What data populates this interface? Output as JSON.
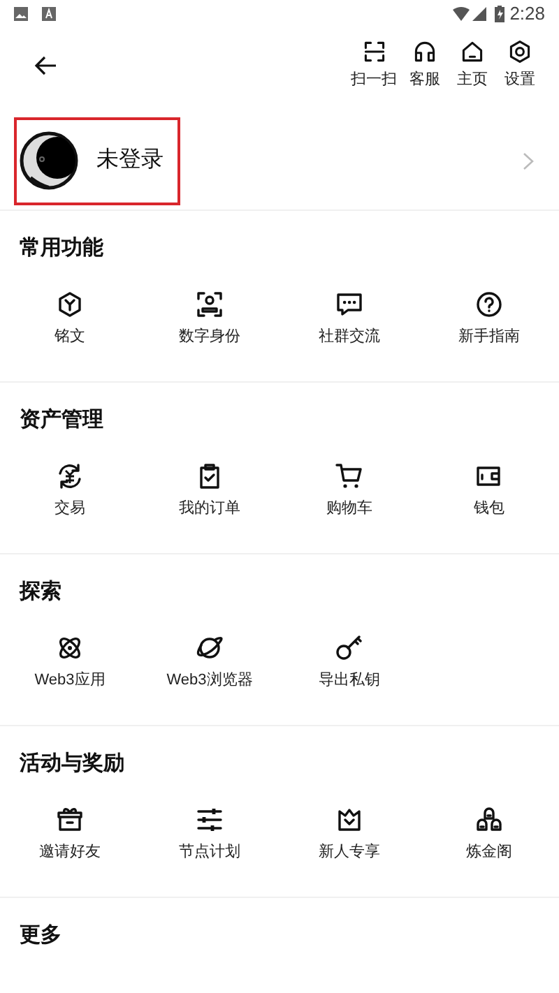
{
  "status_bar": {
    "time": "2:28"
  },
  "header": {
    "actions": [
      {
        "label": "扫一扫"
      },
      {
        "label": "客服"
      },
      {
        "label": "主页"
      },
      {
        "label": "设置"
      }
    ]
  },
  "profile": {
    "name": "未登录",
    "highlighted": true
  },
  "sections": [
    {
      "title": "常用功能",
      "items": [
        {
          "label": "铭文"
        },
        {
          "label": "数字身份"
        },
        {
          "label": "社群交流"
        },
        {
          "label": "新手指南"
        }
      ]
    },
    {
      "title": "资产管理",
      "items": [
        {
          "label": "交易"
        },
        {
          "label": "我的订单"
        },
        {
          "label": "购物车"
        },
        {
          "label": "钱包"
        }
      ]
    },
    {
      "title": "探索",
      "items": [
        {
          "label": "Web3应用"
        },
        {
          "label": "Web3浏览器"
        },
        {
          "label": "导出私钥"
        }
      ]
    },
    {
      "title": "活动与奖励",
      "items": [
        {
          "label": "邀请好友"
        },
        {
          "label": "节点计划"
        },
        {
          "label": "新人专享"
        },
        {
          "label": "炼金阁"
        }
      ]
    },
    {
      "title": "更多"
    }
  ]
}
